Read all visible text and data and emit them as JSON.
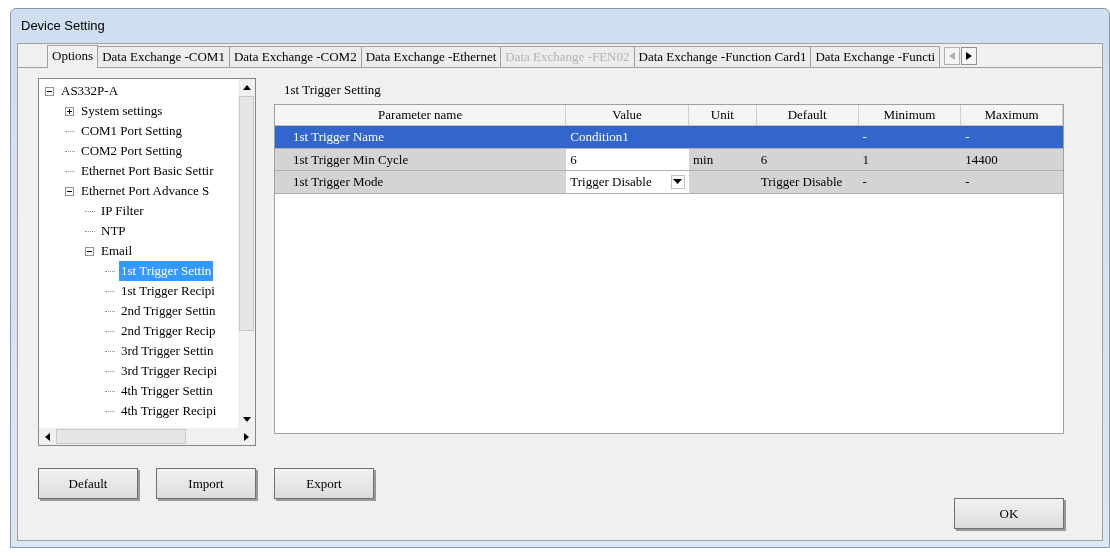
{
  "window": {
    "title": "Device Setting"
  },
  "tabs": [
    {
      "label": "Options",
      "selected": true,
      "disabled": false
    },
    {
      "label": "Data Exchange -COM1",
      "selected": false,
      "disabled": false
    },
    {
      "label": "Data Exchange -COM2",
      "selected": false,
      "disabled": false
    },
    {
      "label": "Data Exchange -Ethernet",
      "selected": false,
      "disabled": false
    },
    {
      "label": "Data Exchange -FEN02",
      "selected": false,
      "disabled": true
    },
    {
      "label": "Data Exchange -Function Card1",
      "selected": false,
      "disabled": false
    },
    {
      "label": "Data Exchange -Functi",
      "selected": false,
      "disabled": false
    }
  ],
  "tree": [
    {
      "label": "AS332P-A",
      "expanded": true,
      "selected": false,
      "children": [
        {
          "label": "System settings",
          "expanded": false,
          "selected": false
        },
        {
          "label": "COM1 Port Setting",
          "selected": false
        },
        {
          "label": "COM2 Port Setting",
          "selected": false
        },
        {
          "label": "Ethernet Port Basic Settir",
          "selected": false
        },
        {
          "label": "Ethernet Port Advance S",
          "expanded": true,
          "selected": false,
          "children": [
            {
              "label": "IP Filter",
              "selected": false
            },
            {
              "label": "NTP",
              "selected": false
            },
            {
              "label": "Email",
              "expanded": true,
              "selected": false,
              "children": [
                {
                  "label": "1st Trigger Settin",
                  "selected": true
                },
                {
                  "label": "1st Trigger Recipi",
                  "selected": false
                },
                {
                  "label": "2nd Trigger Settin",
                  "selected": false
                },
                {
                  "label": "2nd Trigger Recip",
                  "selected": false
                },
                {
                  "label": "3rd Trigger Settin",
                  "selected": false
                },
                {
                  "label": "3rd Trigger Recipi",
                  "selected": false
                },
                {
                  "label": "4th Trigger Settin",
                  "selected": false
                },
                {
                  "label": "4th Trigger Recipi",
                  "selected": false
                }
              ]
            }
          ]
        }
      ]
    }
  ],
  "panel_title": "1st Trigger Setting",
  "table": {
    "columns": [
      "Parameter name",
      "Value",
      "Unit",
      "Default",
      "Minimum",
      "Maximum"
    ],
    "rows": [
      {
        "selected": true,
        "name": "1st Trigger Name",
        "value": {
          "kind": "text",
          "text": "Condition1"
        },
        "unit": "",
        "default": "",
        "minimum": "-",
        "maximum": "-"
      },
      {
        "selected": false,
        "name": "1st Trigger Min Cycle",
        "value": {
          "kind": "input",
          "text": "6"
        },
        "unit": "min",
        "default": "6",
        "minimum": "1",
        "maximum": "14400"
      },
      {
        "selected": false,
        "name": "1st Trigger Mode",
        "value": {
          "kind": "dropdown",
          "text": "Trigger Disable"
        },
        "unit": "",
        "default": "Trigger Disable",
        "minimum": "-",
        "maximum": "-"
      }
    ]
  },
  "buttons": [
    "Default",
    "Import",
    "Export"
  ],
  "ok_button": "OK"
}
